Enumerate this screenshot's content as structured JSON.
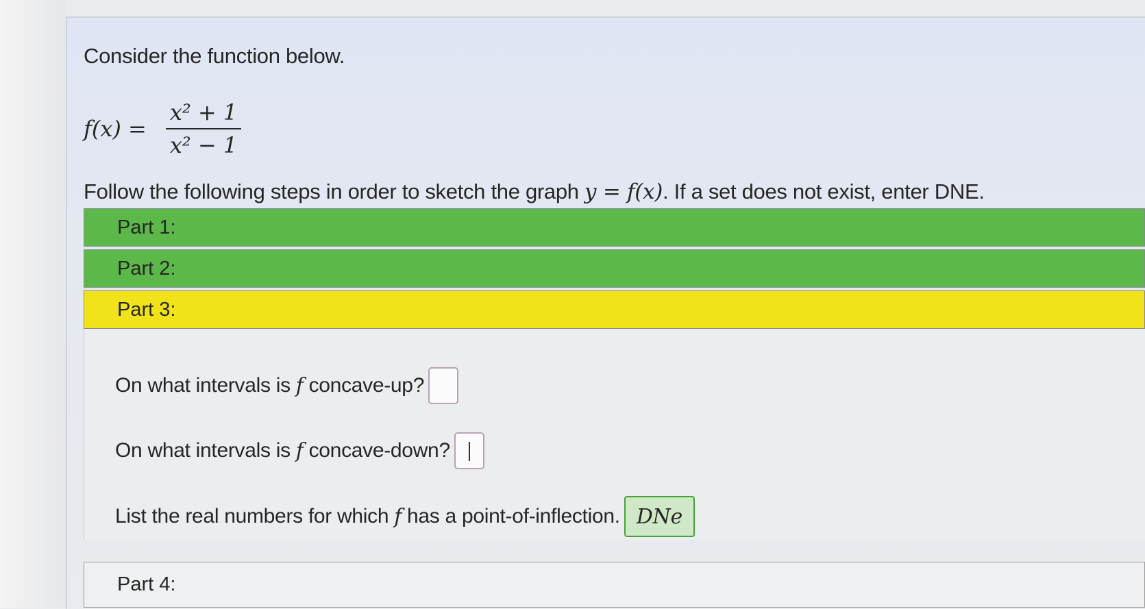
{
  "intro": "Consider the function below.",
  "formula": {
    "lhs": "f(x) =",
    "numerator": "x² + 1",
    "denominator": "x² − 1"
  },
  "instructions": {
    "before": "Follow the following steps in order to sketch the graph ",
    "math": "y = f(x)",
    "after": ". If a set does not exist, enter DNE."
  },
  "parts": {
    "part1": "Part 1:",
    "part2": "Part 2:",
    "part3": "Part 3:",
    "part4": "Part 4:"
  },
  "part_colors": {
    "complete": "#5cb848",
    "current": "#f2e21a"
  },
  "questions": {
    "q1": {
      "before": "On what intervals is",
      "fvar": "f",
      "after": "concave-up?",
      "answer": ""
    },
    "q2": {
      "before": "On what intervals is",
      "fvar": "f",
      "after": "concave-down?",
      "answer": ""
    },
    "q3": {
      "before": "List the real numbers for which",
      "fvar": "f",
      "after": "has a point-of-inflection.",
      "answer": "DNe"
    }
  }
}
